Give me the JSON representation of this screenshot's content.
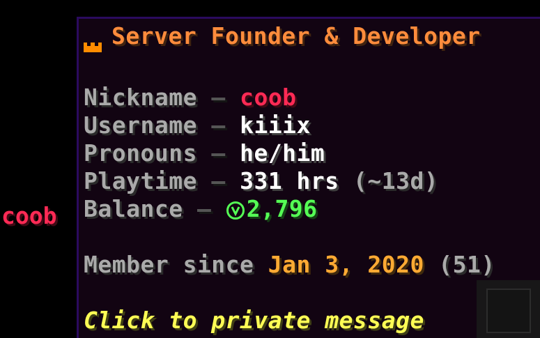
{
  "side_nickname": "coob",
  "header": {
    "icon": "crown-icon",
    "title": "Server Founder & Developer",
    "color": "#ff8c3c"
  },
  "profile": {
    "separator": "—",
    "nickname": {
      "label": "Nickname",
      "value": "coob",
      "color": "#ff2a55"
    },
    "username": {
      "label": "Username",
      "value": "kiiix"
    },
    "pronouns": {
      "label": "Pronouns",
      "value": "he/him"
    },
    "playtime": {
      "label": "Playtime",
      "value": "331 hrs",
      "detail": "(~13d)"
    },
    "balance": {
      "label": "Balance",
      "icon": "coin-icon",
      "value": "2,796",
      "color": "#55ff55"
    }
  },
  "member_since": {
    "label": "Member since",
    "date": "Jan 3, 2020",
    "detail": "(51)"
  },
  "action": {
    "label": "Click to private message",
    "color": "#ffff55"
  }
}
